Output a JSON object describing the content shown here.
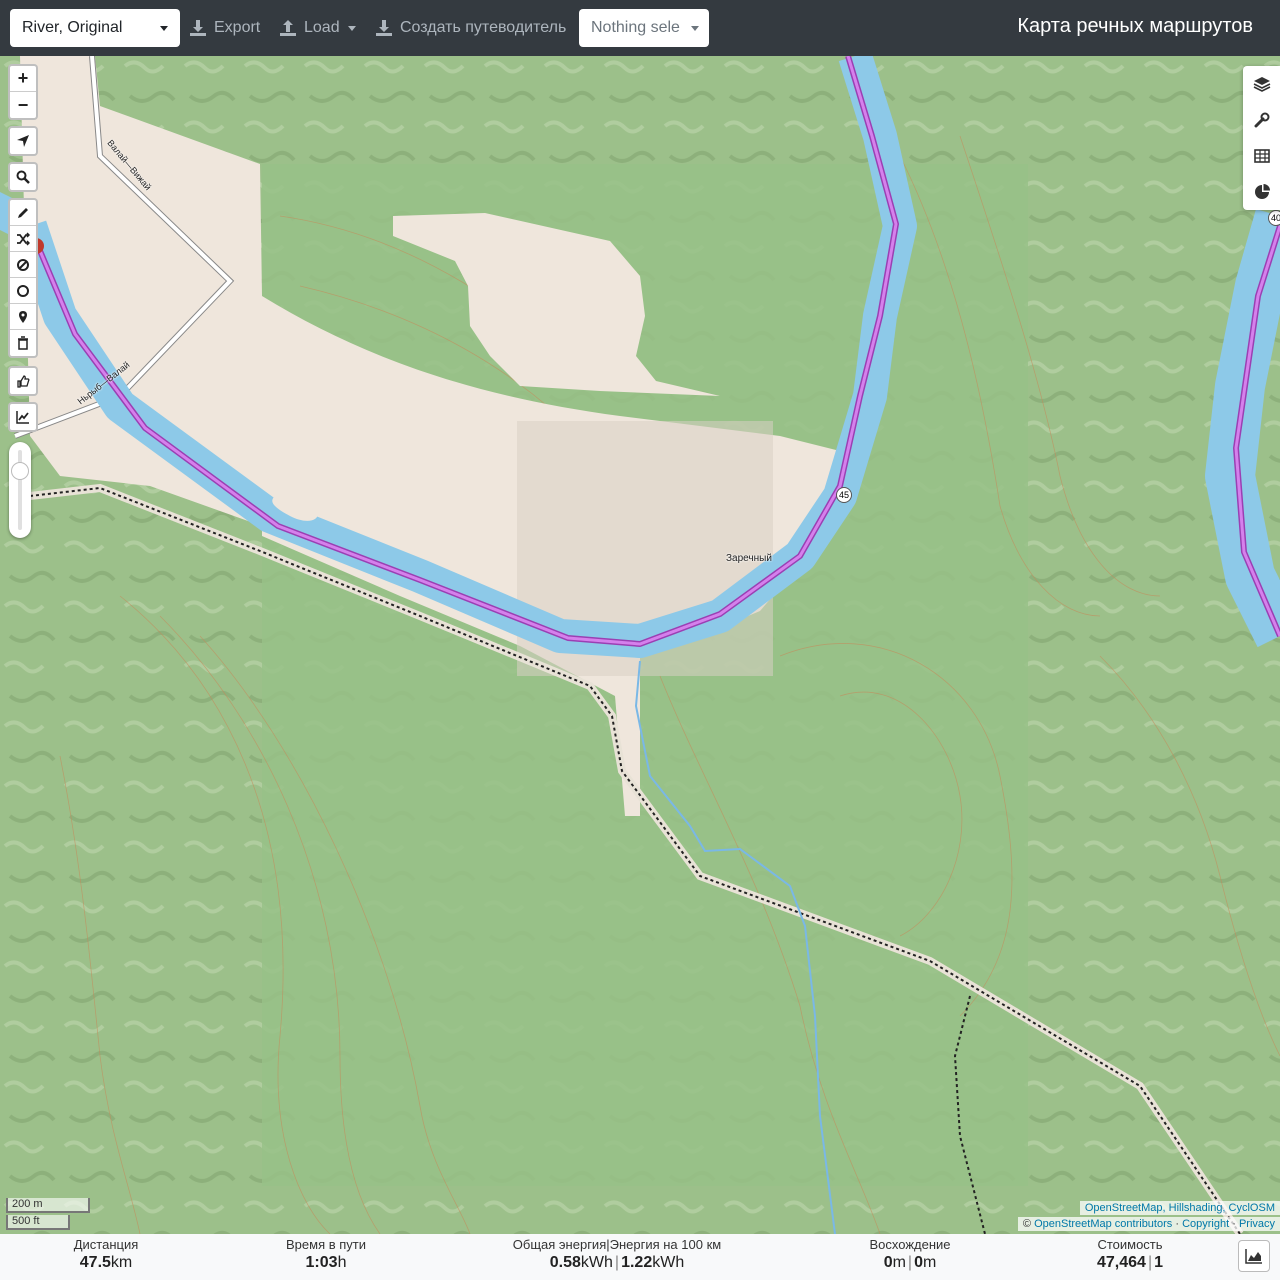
{
  "toolbar": {
    "profile_value": "River, Original",
    "export_label": "Export",
    "load_label": "Load",
    "guide_label": "Создать путеводитель",
    "route_placeholder": "Nothing sele",
    "app_title": "Карта речных маршрутов"
  },
  "map_controls": {
    "zoom_in": "+",
    "zoom_out": "−",
    "zoom_slider_level": 0.2,
    "right_icons": [
      "layers-icon",
      "wrench-icon",
      "table-icon",
      "pie-chart-icon"
    ],
    "left_icons": [
      "locate-icon",
      "search-icon",
      "draw-icon",
      "shuffle-icon",
      "block-icon",
      "circle-icon",
      "waypoint-icon",
      "trash-icon",
      "thumb-icon",
      "elevation-chart-icon"
    ]
  },
  "map_labels": {
    "village": "Заречный",
    "road_shield": "45",
    "road_name_1": "Валай—Вижай",
    "road_name_2": "Ньрыб—Валай",
    "edge_shield": "40"
  },
  "scale": {
    "metric": "200 m",
    "imperial": "500 ft"
  },
  "attribution": {
    "line1": "OpenStreetMap, Hillshading, CyclOSM",
    "line2_prefix": "©",
    "line2_link": "OpenStreetMap contributors",
    "copyright": "Copyright",
    "privacy": "Privacy"
  },
  "stats": {
    "distance_label": "Дистанция",
    "distance_value": "47.5",
    "distance_unit": "km",
    "time_label": "Время в пути",
    "time_value": "1:03",
    "time_unit": "h",
    "energy_label": "Общая энергия|Энергия на 100 км",
    "energy_total": "0.58",
    "energy_total_unit": "kWh",
    "energy_per100": "1.22",
    "energy_per100_unit": "kWh",
    "ascent_label": "Восхождение",
    "ascent_up": "0",
    "ascent_up_unit": "m",
    "ascent_down": "0",
    "ascent_down_unit": "m",
    "cost_label": "Стоимость",
    "cost_value": "47,464",
    "cost_secondary": "1"
  },
  "colors": {
    "toolbar_bg": "#343a40",
    "forest": "#9cc08a",
    "river": "#8dc9e8",
    "route": "#d06ae6",
    "clearing": "#efe6dc"
  }
}
